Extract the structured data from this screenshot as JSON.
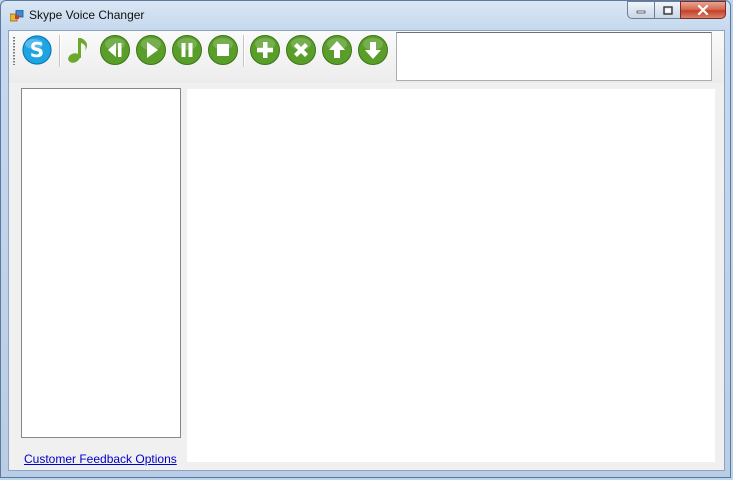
{
  "window": {
    "title": "Skype Voice Changer",
    "caption_buttons": [
      "minimize",
      "maximize",
      "close"
    ]
  },
  "toolbar": {
    "icons": [
      "skype-icon",
      "music-note-icon",
      "rewind-icon",
      "play-icon",
      "pause-icon",
      "stop-icon",
      "add-icon",
      "remove-icon",
      "move-up-icon",
      "move-down-icon"
    ],
    "track_display": ""
  },
  "links": {
    "feedback": "Customer Feedback Options"
  },
  "colors": {
    "green_button": "#5a9e2a",
    "skype_blue": "#1ea4e3",
    "link": "#0000cc"
  }
}
